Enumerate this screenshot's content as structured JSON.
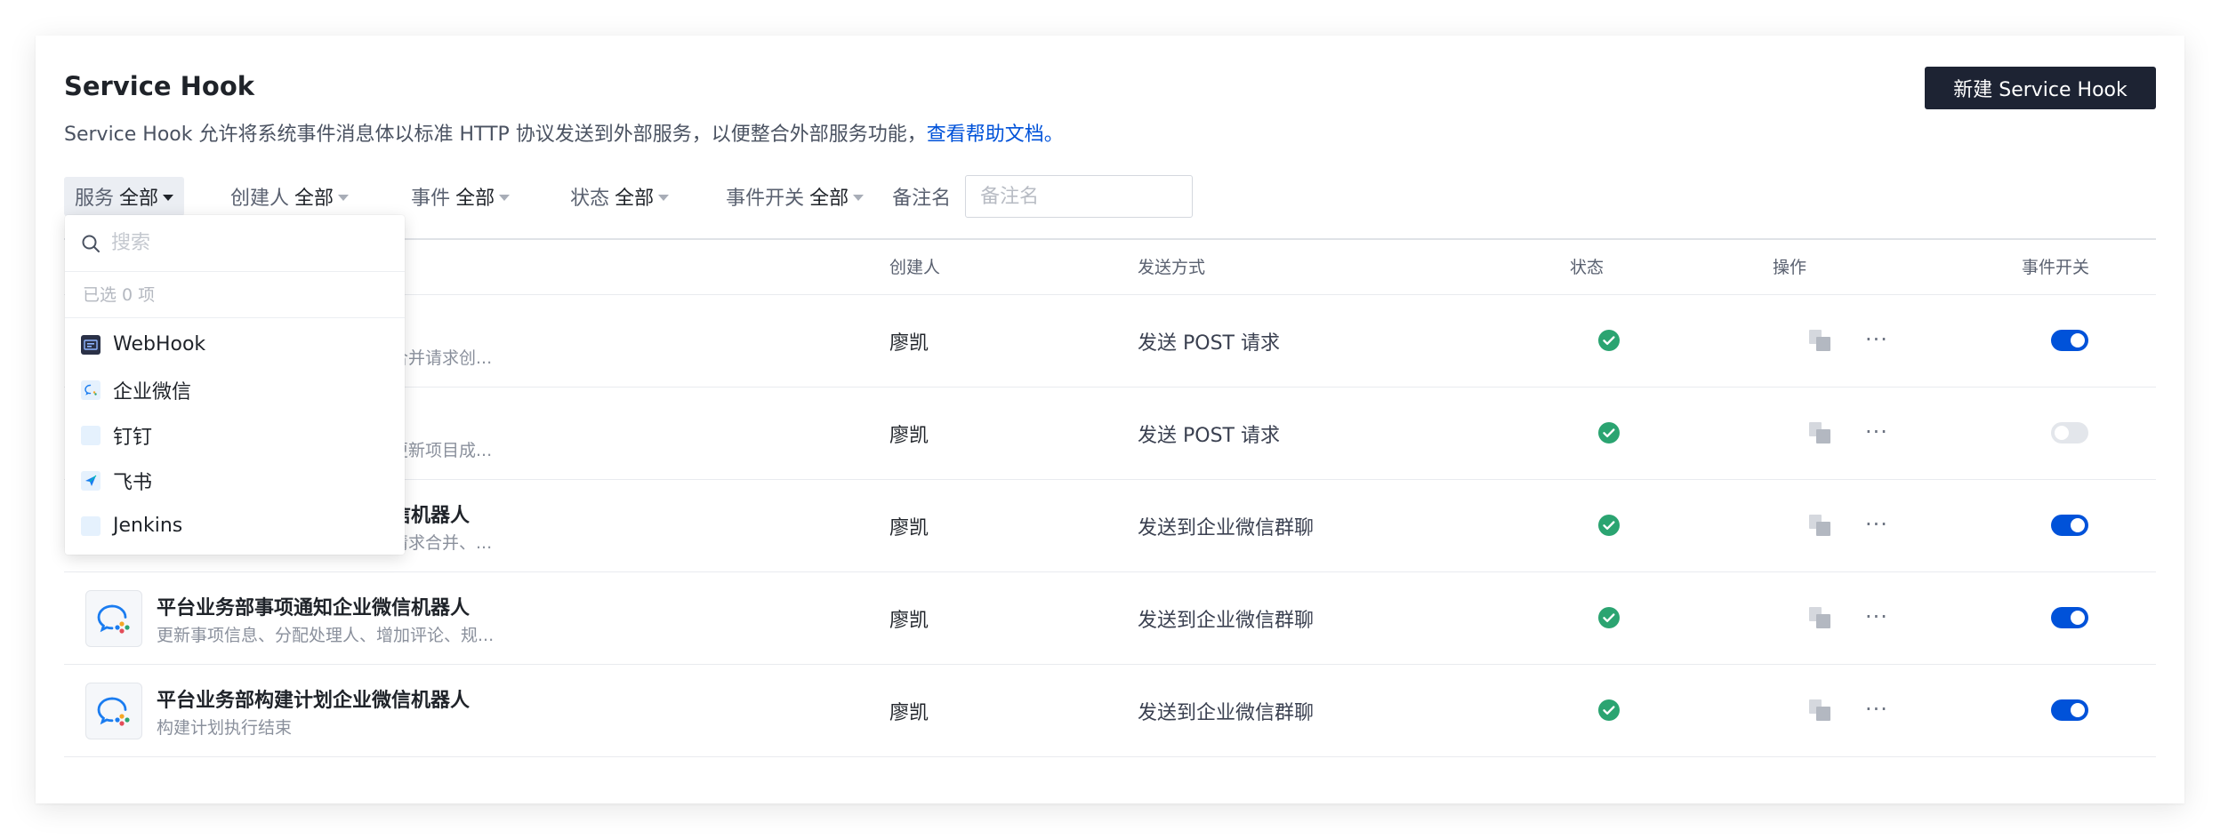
{
  "header": {
    "title": "Service Hook",
    "subtitle": "Service Hook 允许将系统事件消息体以标准 HTTP 协议发送到外部服务，以便整合外部服务功能，",
    "help_link": "查看帮助文档。",
    "new_button": "新建 Service Hook"
  },
  "filters": {
    "service": {
      "label": "服务",
      "value": "全部"
    },
    "creator": {
      "label": "创建人",
      "value": "全部"
    },
    "event": {
      "label": "事件",
      "value": "全部"
    },
    "status": {
      "label": "状态",
      "value": "全部"
    },
    "event_switch": {
      "label": "事件开关",
      "value": "全部"
    },
    "note": {
      "label": "备注名",
      "placeholder": "备注名"
    }
  },
  "table": {
    "columns": {
      "creator": "创建人",
      "method": "发送方式",
      "status": "状态",
      "actions": "操作",
      "event_switch": "事件开关"
    },
    "rows": [
      {
        "name": "",
        "desc": "合并请求创...",
        "creator": "廖凯",
        "method": "发送 POST 请求",
        "enabled": true
      },
      {
        "name": "",
        "desc": "更新项目成...",
        "creator": "廖凯",
        "method": "发送 POST 请求",
        "enabled": false
      },
      {
        "name": "信机器人",
        "desc": "请求合并、...",
        "creator": "廖凯",
        "method": "发送到企业微信群聊",
        "enabled": true
      },
      {
        "name": "平台业务部事项通知企业微信机器人",
        "desc": "更新事项信息、分配处理人、增加评论、规...",
        "creator": "廖凯",
        "method": "发送到企业微信群聊",
        "enabled": true
      },
      {
        "name": "平台业务部构建计划企业微信机器人",
        "desc": "构建计划执行结束",
        "creator": "廖凯",
        "method": "发送到企业微信群聊",
        "enabled": true
      }
    ]
  },
  "dropdown": {
    "search_placeholder": "搜索",
    "selected_count": "已选 0 项",
    "items": [
      {
        "label": "WebHook",
        "icon": "webhook-icon"
      },
      {
        "label": "企业微信",
        "icon": "wecom-icon"
      },
      {
        "label": "钉钉",
        "icon": "dingtalk-icon"
      },
      {
        "label": "飞书",
        "icon": "feishu-icon"
      },
      {
        "label": "Jenkins",
        "icon": "jenkins-icon"
      }
    ]
  },
  "colors": {
    "primary": "#0052d9",
    "success": "#2ba471",
    "dark_button": "#1d2333"
  }
}
